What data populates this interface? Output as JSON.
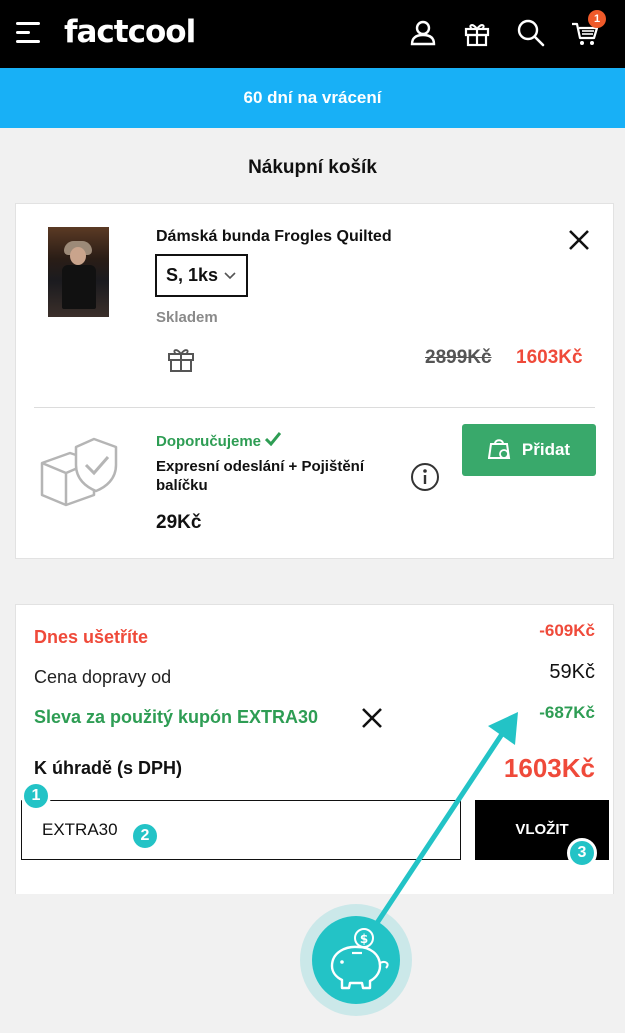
{
  "header": {
    "logo": "factcool",
    "cart_count": "1"
  },
  "promo_banner": "60 dní na vrácení",
  "page_title": "Nákupní košík",
  "cart_item": {
    "name": "Dámská bunda Frogles Quilted",
    "size_qty": "S, 1ks",
    "stock": "Skladem",
    "old_price": "2899Kč",
    "new_price": "1603Kč"
  },
  "recommendation": {
    "label": "Doporučujeme",
    "title": "Expresní odeslání + Pojištění balíčku",
    "price": "29Kč",
    "add_label": "Přidat"
  },
  "summary": {
    "savings_label": "Dnes ušetříte",
    "savings_value": "-609Kč",
    "shipping_label": "Cena dopravy od",
    "shipping_value": "59Kč",
    "coupon_label": "Sleva za použitý kupón EXTRA30",
    "coupon_value": "-687Kč",
    "total_label": "K úhradě (s DPH)",
    "total_value": "1603Kč"
  },
  "coupon": {
    "input_value": "EXTRA30",
    "submit_label": "VLOŽIT"
  },
  "steps": [
    "1",
    "2",
    "3"
  ],
  "colors": {
    "promo": "#18b0f6",
    "sale_red": "#ef4a3a",
    "green": "#2e9d54",
    "add_button": "#39a96b",
    "annotation_teal": "#23c3c6"
  }
}
